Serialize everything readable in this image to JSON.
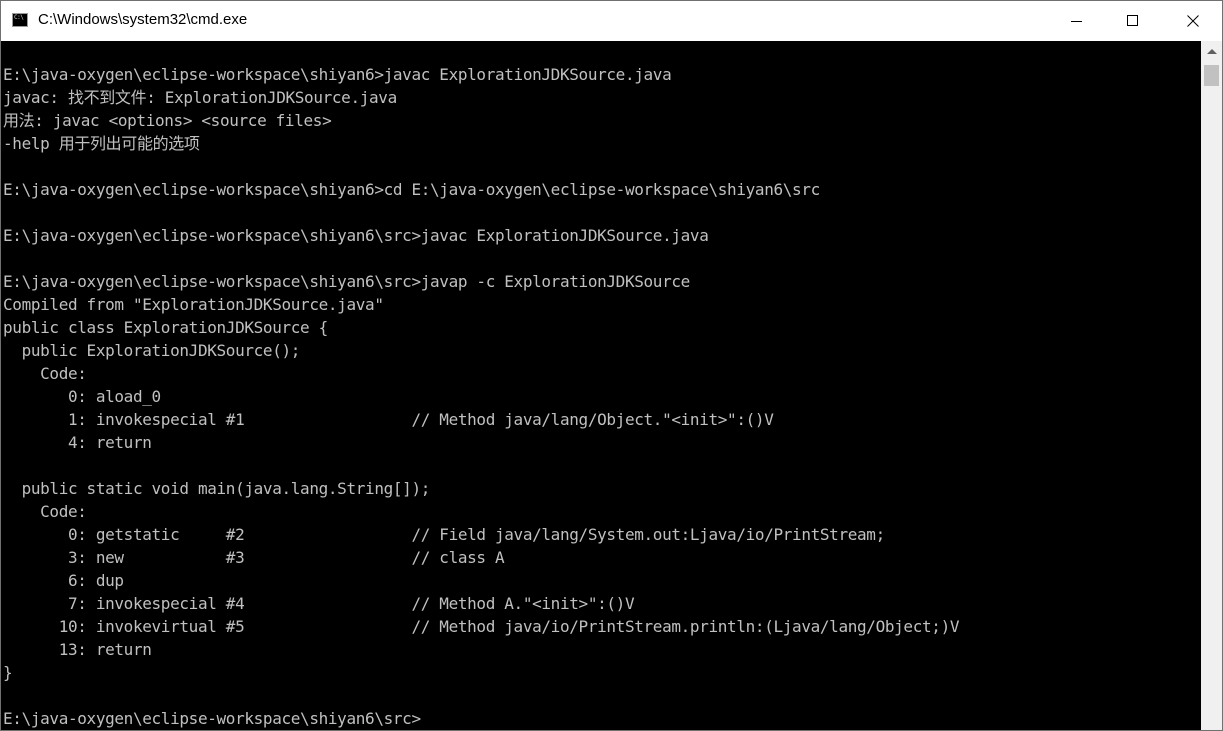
{
  "window": {
    "title": "C:\\Windows\\system32\\cmd.exe",
    "icon": "cmd-icon",
    "icon_glyph": "C:\\"
  },
  "controls": {
    "minimize": "minimize-icon",
    "maximize": "maximize-icon",
    "close": "close-icon"
  },
  "console": {
    "lines": [
      "E:\\java-oxygen\\eclipse-workspace\\shiyan6>javac ExplorationJDKSource.java",
      "javac: 找不到文件: ExplorationJDKSource.java",
      "用法: javac <options> <source files>",
      "-help 用于列出可能的选项",
      "",
      "E:\\java-oxygen\\eclipse-workspace\\shiyan6>cd E:\\java-oxygen\\eclipse-workspace\\shiyan6\\src",
      "",
      "E:\\java-oxygen\\eclipse-workspace\\shiyan6\\src>javac ExplorationJDKSource.java",
      "",
      "E:\\java-oxygen\\eclipse-workspace\\shiyan6\\src>javap -c ExplorationJDKSource",
      "Compiled from \"ExplorationJDKSource.java\"",
      "public class ExplorationJDKSource {",
      "  public ExplorationJDKSource();",
      "    Code:",
      "       0: aload_0",
      "       1: invokespecial #1                  // Method java/lang/Object.\"<init>\":()V",
      "       4: return",
      "",
      "  public static void main(java.lang.String[]);",
      "    Code:",
      "       0: getstatic     #2                  // Field java/lang/System.out:Ljava/io/PrintStream;",
      "       3: new           #3                  // class A",
      "       6: dup",
      "       7: invokespecial #4                  // Method A.\"<init>\":()V",
      "      10: invokevirtual #5                  // Method java/io/PrintStream.println:(Ljava/lang/Object;)V",
      "      13: return",
      "}",
      "",
      "E:\\java-oxygen\\eclipse-workspace\\shiyan6\\src>"
    ]
  },
  "colors": {
    "console_background": "#000000",
    "console_text": "#c0c0c0",
    "titlebar": "#ffffff",
    "scrollbar_track": "#f0f0f0",
    "scrollbar_thumb": "#c1c1c1"
  }
}
